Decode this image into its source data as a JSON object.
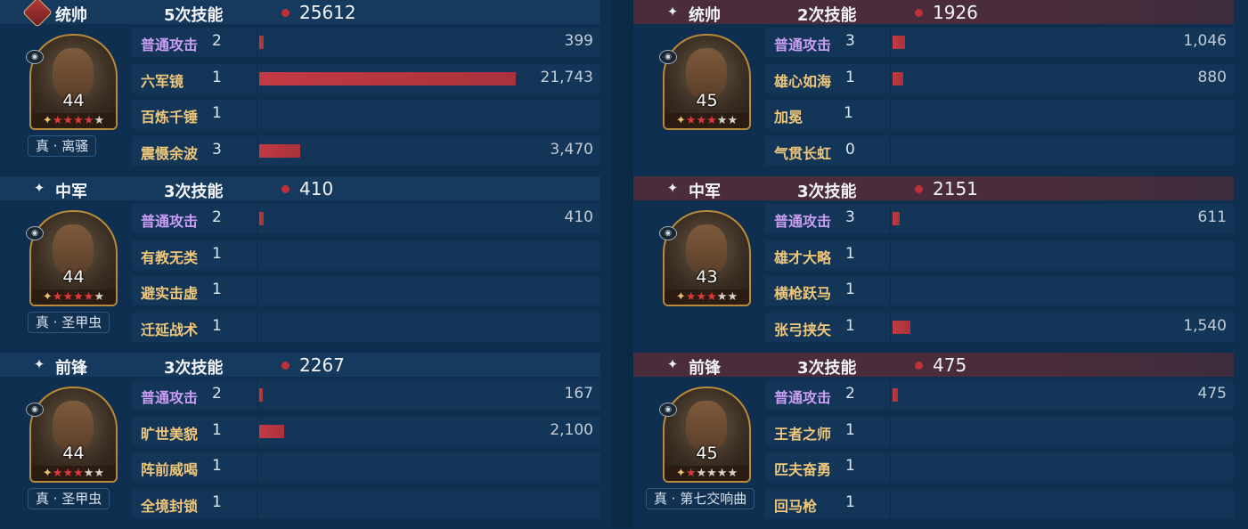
{
  "left_team": [
    {
      "role": "统帅",
      "role_icon": "commander-badge-icon",
      "casts": "5次技能",
      "total": "25612",
      "level": "44",
      "stars_red": 4,
      "stars_total": 5,
      "tactic": "真 · 离骚",
      "skills": [
        {
          "name": "普通攻击",
          "level": "2",
          "damage": "399",
          "value": 399,
          "type": "normal"
        },
        {
          "name": "六军镜",
          "level": "1",
          "damage": "21,743",
          "value": 21743,
          "type": "skill"
        },
        {
          "name": "百炼千锤",
          "level": "1",
          "damage": "",
          "value": 0,
          "type": "skill"
        },
        {
          "name": "震慑余波",
          "level": "3",
          "damage": "3,470",
          "value": 3470,
          "type": "skill"
        }
      ]
    },
    {
      "role": "中军",
      "role_icon": "sparkle-icon",
      "casts": "3次技能",
      "total": "410",
      "level": "44",
      "stars_red": 4,
      "stars_total": 5,
      "tactic": "真 · 圣甲虫",
      "skills": [
        {
          "name": "普通攻击",
          "level": "2",
          "damage": "410",
          "value": 410,
          "type": "normal"
        },
        {
          "name": "有教无类",
          "level": "1",
          "damage": "",
          "value": 0,
          "type": "skill"
        },
        {
          "name": "避实击虚",
          "level": "1",
          "damage": "",
          "value": 0,
          "type": "skill"
        },
        {
          "name": "迁延战术",
          "level": "1",
          "damage": "",
          "value": 0,
          "type": "skill"
        }
      ]
    },
    {
      "role": "前锋",
      "role_icon": "sparkle-icon",
      "casts": "3次技能",
      "total": "2267",
      "level": "44",
      "stars_red": 3,
      "stars_total": 5,
      "tactic": "真 · 圣甲虫",
      "skills": [
        {
          "name": "普通攻击",
          "level": "2",
          "damage": "167",
          "value": 167,
          "type": "normal"
        },
        {
          "name": "旷世美貌",
          "level": "1",
          "damage": "2,100",
          "value": 2100,
          "type": "skill"
        },
        {
          "name": "阵前威喝",
          "level": "1",
          "damage": "",
          "value": 0,
          "type": "skill"
        },
        {
          "name": "全境封锁",
          "level": "1",
          "damage": "",
          "value": 0,
          "type": "skill"
        }
      ]
    }
  ],
  "right_team": [
    {
      "role": "统帅",
      "role_icon": "sparkle-icon",
      "casts": "2次技能",
      "total": "1926",
      "level": "45",
      "stars_red": 3,
      "stars_total": 5,
      "tactic": "",
      "skills": [
        {
          "name": "普通攻击",
          "level": "3",
          "damage": "1,046",
          "value": 1046,
          "type": "normal"
        },
        {
          "name": "雄心如海",
          "level": "1",
          "damage": "880",
          "value": 880,
          "type": "skill"
        },
        {
          "name": "加冕",
          "level": "1",
          "damage": "",
          "value": 0,
          "type": "skill"
        },
        {
          "name": "气贯长虹",
          "level": "0",
          "damage": "",
          "value": 0,
          "type": "skill"
        }
      ]
    },
    {
      "role": "中军",
      "role_icon": "sparkle-icon",
      "casts": "3次技能",
      "total": "2151",
      "level": "43",
      "stars_red": 3,
      "stars_total": 5,
      "tactic": "",
      "skills": [
        {
          "name": "普通攻击",
          "level": "3",
          "damage": "611",
          "value": 611,
          "type": "normal"
        },
        {
          "name": "雄才大略",
          "level": "1",
          "damage": "",
          "value": 0,
          "type": "skill"
        },
        {
          "name": "横枪跃马",
          "level": "1",
          "damage": "",
          "value": 0,
          "type": "skill"
        },
        {
          "name": "张弓挟矢",
          "level": "1",
          "damage": "1,540",
          "value": 1540,
          "type": "skill"
        }
      ]
    },
    {
      "role": "前锋",
      "role_icon": "sparkle-icon",
      "casts": "3次技能",
      "total": "475",
      "level": "45",
      "stars_red": 1,
      "stars_total": 5,
      "tactic": "真 · 第七交响曲",
      "skills": [
        {
          "name": "普通攻击",
          "level": "2",
          "damage": "475",
          "value": 475,
          "type": "normal"
        },
        {
          "name": "王者之师",
          "level": "1",
          "damage": "",
          "value": 0,
          "type": "skill"
        },
        {
          "name": "匹夫奋勇",
          "level": "1",
          "damage": "",
          "value": 0,
          "type": "skill"
        },
        {
          "name": "回马枪",
          "level": "1",
          "damage": "",
          "value": 0,
          "type": "skill"
        }
      ]
    }
  ],
  "bar_scale_max": 21743,
  "colors": {
    "bar": "#c23a44",
    "normal_attack": "#c99ef2",
    "skill": "#f0c77a",
    "star_red": "#e0383a"
  }
}
